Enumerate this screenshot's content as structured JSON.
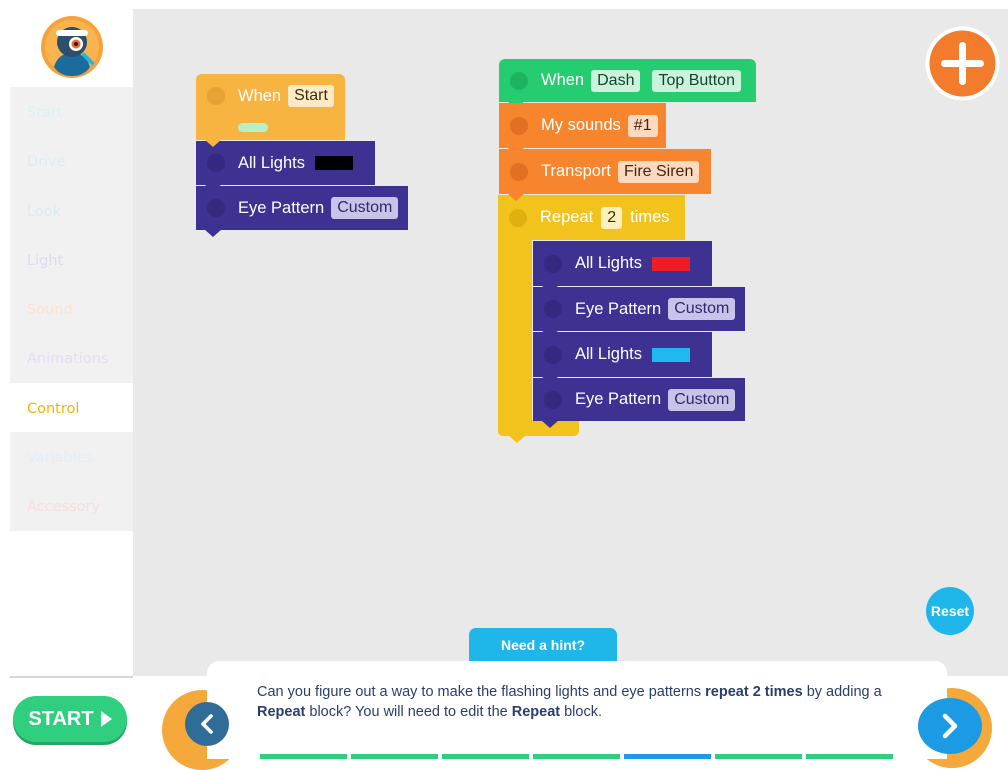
{
  "sidebar": {
    "categories": [
      {
        "label": "Start",
        "color": "#d9f2f4"
      },
      {
        "label": "Drive",
        "color": "#d8eef5"
      },
      {
        "label": "Look",
        "color": "#d8ecf5"
      },
      {
        "label": "Light",
        "color": "#dcdcf0"
      },
      {
        "label": "Sound",
        "color": "#fbe4cf"
      },
      {
        "label": "Animations",
        "color": "#e7dcf2"
      },
      {
        "label": "Control",
        "color": "#f0b400"
      },
      {
        "label": "Variables",
        "color": "#e2eef7"
      },
      {
        "label": "Accessory",
        "color": "#f8dde0"
      }
    ],
    "active_category": "Control",
    "start_label": "START"
  },
  "program_left": {
    "when_label": "When",
    "trigger": "Start",
    "all_lights_label": "All Lights",
    "all_lights_color": "#000000",
    "eye_pattern_label": "Eye Pattern",
    "eye_pattern_value": "Custom"
  },
  "program_right": {
    "when_label": "When",
    "robot": "Dash",
    "event": "Top Button",
    "my_sounds_label": "My sounds",
    "my_sounds_value": "#1",
    "transport_label": "Transport",
    "transport_value": "Fire Siren",
    "repeat_label": "Repeat",
    "repeat_count": "2",
    "repeat_suffix": "times",
    "inner": [
      {
        "label": "All Lights",
        "kind": "light",
        "color": "#ee1c25"
      },
      {
        "label": "Eye Pattern",
        "kind": "eye",
        "value": "Custom"
      },
      {
        "label": "All Lights",
        "kind": "light",
        "color": "#1fb8ef"
      },
      {
        "label": "Eye Pattern",
        "kind": "eye",
        "value": "Custom"
      }
    ]
  },
  "controls": {
    "reset_label": "Reset",
    "hint_tab_label": "Need a hint?"
  },
  "hint": {
    "p1": "Can you figure out a way to make the flashing lights and eye patterns ",
    "b1": "repeat 2 times",
    "p2": " by adding a ",
    "b2": "Repeat",
    "p3": " block? You will need to edit the ",
    "b3": "Repeat",
    "p4": " block."
  },
  "progress_steps": [
    {
      "state": "done",
      "color": "#2fcf7f"
    },
    {
      "state": "done",
      "color": "#2fcf7f"
    },
    {
      "state": "done",
      "color": "#2fcf7f"
    },
    {
      "state": "done",
      "color": "#2fcf7f"
    },
    {
      "state": "current",
      "color": "#1c9be4"
    },
    {
      "state": "upcoming",
      "color": "#2fcf7f"
    },
    {
      "state": "upcoming",
      "color": "#2fcf7f"
    }
  ],
  "colors": {
    "canvas": "#e9e9e9",
    "orange_add": "#f37b2c",
    "reset": "#1fb6ea",
    "start_green": "#2fcf7f"
  }
}
